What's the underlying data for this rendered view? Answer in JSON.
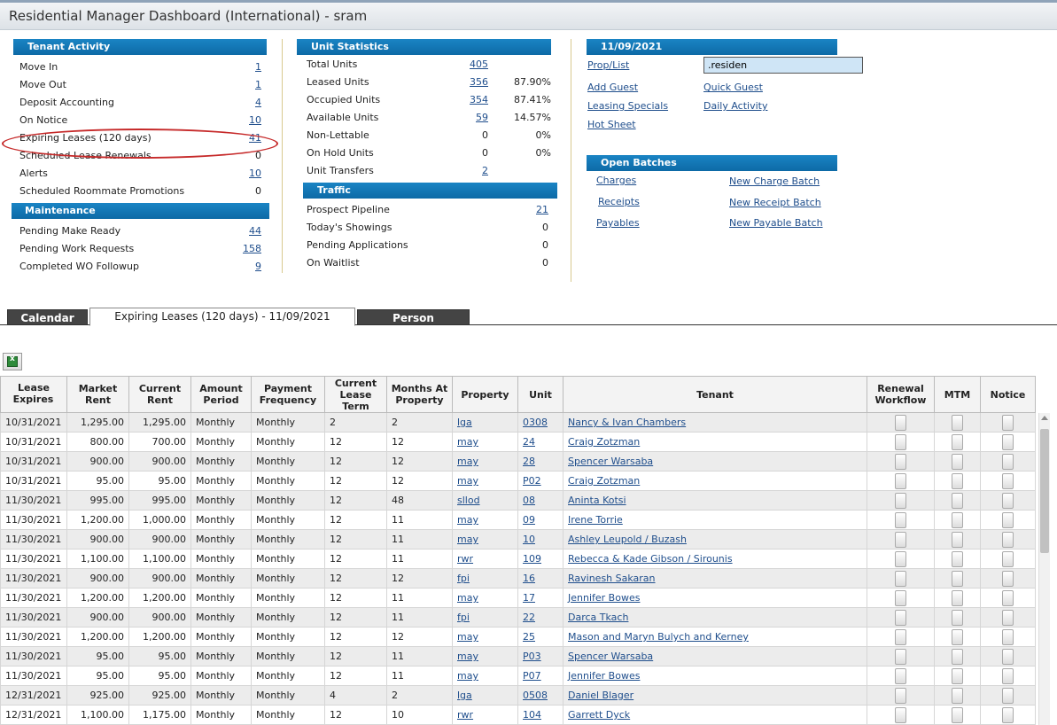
{
  "window": {
    "title": "Residential Manager Dashboard (International) - sram"
  },
  "tenant_activity": {
    "header": "Tenant Activity",
    "items": [
      {
        "label": "Move In",
        "value": "1",
        "link": true
      },
      {
        "label": "Move Out",
        "value": "1",
        "link": true
      },
      {
        "label": "Deposit Accounting",
        "value": "4",
        "link": true
      },
      {
        "label": "On Notice",
        "value": "10",
        "link": true
      },
      {
        "label": "Expiring Leases (120 days)",
        "value": "41",
        "link": true
      },
      {
        "label": "Scheduled Lease Renewals",
        "value": "0",
        "link": false
      },
      {
        "label": "Alerts",
        "value": "10",
        "link": true
      },
      {
        "label": "Scheduled Roommate Promotions",
        "value": "0",
        "link": false
      }
    ]
  },
  "maintenance": {
    "header": "Maintenance",
    "items": [
      {
        "label": "Pending Make Ready",
        "value": "44",
        "link": true
      },
      {
        "label": "Pending Work Requests",
        "value": "158",
        "link": true
      },
      {
        "label": "Completed WO Followup",
        "value": "9",
        "link": true
      }
    ]
  },
  "unit_statistics": {
    "header": "Unit Statistics",
    "items": [
      {
        "label": "Total Units",
        "value": "405",
        "link": true,
        "pct": ""
      },
      {
        "label": "Leased Units",
        "value": "356",
        "link": true,
        "pct": "87.90%"
      },
      {
        "label": "Occupied Units",
        "value": "354",
        "link": true,
        "pct": "87.41%"
      },
      {
        "label": "Available Units",
        "value": "59",
        "link": true,
        "pct": "14.57%"
      },
      {
        "label": "Non-Lettable",
        "value": "0",
        "link": false,
        "pct": "0%"
      },
      {
        "label": "On Hold Units",
        "value": "0",
        "link": false,
        "pct": "0%"
      },
      {
        "label": "Unit Transfers",
        "value": "2",
        "link": true,
        "pct": ""
      }
    ]
  },
  "traffic": {
    "header": "Traffic",
    "items": [
      {
        "label": "Prospect Pipeline",
        "value": "21",
        "link": true
      },
      {
        "label": "Today's Showings",
        "value": "0",
        "link": false
      },
      {
        "label": "Pending Applications",
        "value": "0",
        "link": false
      },
      {
        "label": "On Waitlist",
        "value": "0",
        "link": false
      }
    ]
  },
  "date_panel": {
    "header": "11/09/2021",
    "prop_list_label": "Prop/List",
    "prop_list_value": ".residen",
    "links": [
      "Add Guest",
      "Quick Guest",
      "Leasing Specials",
      "Daily Activity",
      "Hot Sheet"
    ]
  },
  "open_batches": {
    "header": "Open Batches",
    "left": [
      "Charges",
      "Receipts",
      "Payables"
    ],
    "right": [
      "New Charge Batch",
      "New Receipt Batch",
      "New Payable Batch"
    ]
  },
  "tabs": [
    "Calendar",
    "Expiring Leases (120 days) - 11/09/2021",
    "Person Search"
  ],
  "table": {
    "headers": [
      "Lease Expires",
      "Market Rent",
      "Current Rent",
      "Amount Period",
      "Payment Frequency",
      "Current Lease Term",
      "Months At Property",
      "Property",
      "Unit",
      "Tenant",
      "Renewal Workflow",
      "MTM",
      "Notice"
    ],
    "sort_indicator": "▲",
    "rows": [
      [
        "10/31/2021",
        "1,295.00",
        "1,295.00",
        "Monthly",
        "Monthly",
        "2",
        "2",
        "lga",
        "0308",
        "Nancy & Ivan Chambers"
      ],
      [
        "10/31/2021",
        "800.00",
        "700.00",
        "Monthly",
        "Monthly",
        "12",
        "12",
        "may",
        "24",
        "Craig Zotzman"
      ],
      [
        "10/31/2021",
        "900.00",
        "900.00",
        "Monthly",
        "Monthly",
        "12",
        "12",
        "may",
        "28",
        "Spencer Warsaba"
      ],
      [
        "10/31/2021",
        "95.00",
        "95.00",
        "Monthly",
        "Monthly",
        "12",
        "12",
        "may",
        "P02",
        "Craig Zotzman"
      ],
      [
        "11/30/2021",
        "995.00",
        "995.00",
        "Monthly",
        "Monthly",
        "12",
        "48",
        "sllod",
        "08",
        "Aninta Kotsi"
      ],
      [
        "11/30/2021",
        "1,200.00",
        "1,000.00",
        "Monthly",
        "Monthly",
        "12",
        "11",
        "may",
        "09",
        "Irene Torrie"
      ],
      [
        "11/30/2021",
        "900.00",
        "900.00",
        "Monthly",
        "Monthly",
        "12",
        "11",
        "may",
        "10",
        "Ashley Leupold / Buzash"
      ],
      [
        "11/30/2021",
        "1,100.00",
        "1,100.00",
        "Monthly",
        "Monthly",
        "12",
        "11",
        "rwr",
        "109",
        "Rebecca & Kade Gibson / Sirounis"
      ],
      [
        "11/30/2021",
        "900.00",
        "900.00",
        "Monthly",
        "Monthly",
        "12",
        "12",
        "fpi",
        "16",
        "Ravinesh Sakaran"
      ],
      [
        "11/30/2021",
        "1,200.00",
        "1,200.00",
        "Monthly",
        "Monthly",
        "12",
        "11",
        "may",
        "17",
        "Jennifer Bowes"
      ],
      [
        "11/30/2021",
        "900.00",
        "900.00",
        "Monthly",
        "Monthly",
        "12",
        "11",
        "fpi",
        "22",
        "Darca Tkach"
      ],
      [
        "11/30/2021",
        "1,200.00",
        "1,200.00",
        "Monthly",
        "Monthly",
        "12",
        "12",
        "may",
        "25",
        "Mason and Maryn Bulych and Kerney"
      ],
      [
        "11/30/2021",
        "95.00",
        "95.00",
        "Monthly",
        "Monthly",
        "12",
        "11",
        "may",
        "P03",
        "Spencer Warsaba"
      ],
      [
        "11/30/2021",
        "95.00",
        "95.00",
        "Monthly",
        "Monthly",
        "12",
        "11",
        "may",
        "P07",
        "Jennifer Bowes"
      ],
      [
        "12/31/2021",
        "925.00",
        "925.00",
        "Monthly",
        "Monthly",
        "4",
        "2",
        "lga",
        "0508",
        "Daniel Blager"
      ],
      [
        "12/31/2021",
        "1,100.00",
        "1,175.00",
        "Monthly",
        "Monthly",
        "12",
        "10",
        "rwr",
        "104",
        "Garrett Dyck"
      ]
    ]
  }
}
